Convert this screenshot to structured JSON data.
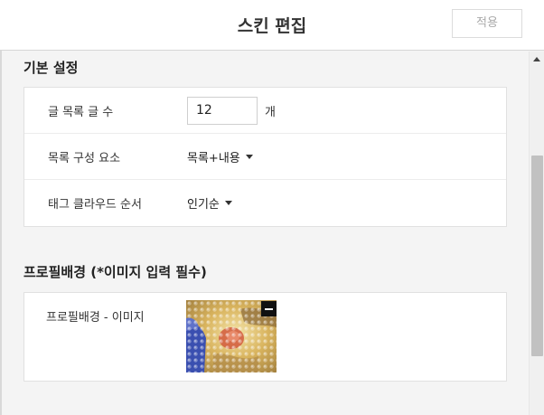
{
  "header": {
    "title": "스킨 편집",
    "apply_label": "적용"
  },
  "basic_settings": {
    "section_title": "기본 설정",
    "rows": [
      {
        "label": "글 목록 글 수",
        "value": "12",
        "unit": "개"
      },
      {
        "label": "목록 구성 요소",
        "selected": "목록+내용"
      },
      {
        "label": "태그 클라우드 순서",
        "selected": "인기순"
      }
    ]
  },
  "profile_bg": {
    "section_title": "프로필배경 (*이미지 입력 필수)",
    "row_label": "프로필배경 - 이미지",
    "thumbnail_icon": "remove-icon"
  },
  "colors": {
    "accent_thumbnail_tones": [
      "#e8c46b",
      "#c9a255",
      "#3a4fb0",
      "#d25a3d"
    ]
  }
}
